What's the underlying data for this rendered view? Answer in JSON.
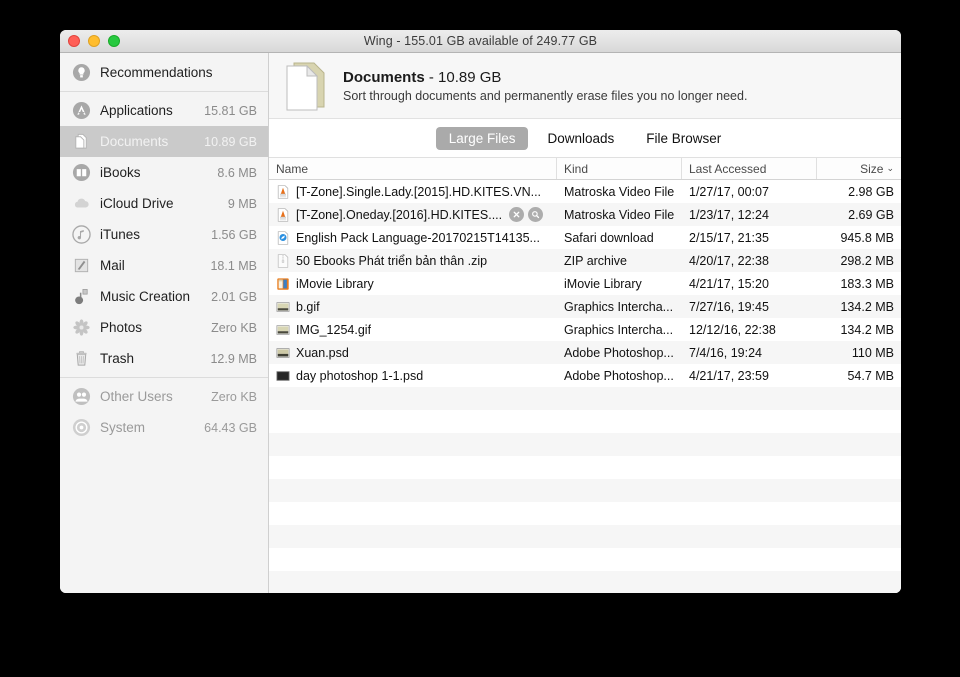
{
  "window": {
    "title": "Wing - 155.01 GB available of 249.77 GB"
  },
  "traffic": {
    "close": "close-button",
    "minimize": "minimize-button",
    "zoom": "zoom-button"
  },
  "sidebar": {
    "items": [
      {
        "label": "Recommendations",
        "size": "",
        "icon": "lightbulb-icon",
        "selected": false,
        "dim": false
      },
      {
        "label": "Applications",
        "size": "15.81 GB",
        "icon": "app-store-icon",
        "selected": false,
        "dim": false
      },
      {
        "label": "Documents",
        "size": "10.89 GB",
        "icon": "documents-icon",
        "selected": true,
        "dim": false
      },
      {
        "label": "iBooks",
        "size": "8.6 MB",
        "icon": "book-icon",
        "selected": false,
        "dim": false
      },
      {
        "label": "iCloud Drive",
        "size": "9 MB",
        "icon": "cloud-icon",
        "selected": false,
        "dim": false
      },
      {
        "label": "iTunes",
        "size": "1.56 GB",
        "icon": "music-note-icon",
        "selected": false,
        "dim": false
      },
      {
        "label": "Mail",
        "size": "18.1 MB",
        "icon": "mail-stamp-icon",
        "selected": false,
        "dim": false
      },
      {
        "label": "Music Creation",
        "size": "2.01 GB",
        "icon": "guitar-icon",
        "selected": false,
        "dim": false
      },
      {
        "label": "Photos",
        "size": "Zero KB",
        "icon": "photos-flower-icon",
        "selected": false,
        "dim": false
      },
      {
        "label": "Trash",
        "size": "12.9 MB",
        "icon": "trash-icon",
        "selected": false,
        "dim": false
      },
      {
        "label": "Other Users",
        "size": "Zero KB",
        "icon": "users-icon",
        "selected": false,
        "dim": true
      },
      {
        "label": "System",
        "size": "64.43 GB",
        "icon": "system-gear-icon",
        "selected": false,
        "dim": true
      }
    ]
  },
  "header": {
    "icon": "documents-stack-icon",
    "title_name": "Documents",
    "title_size": " - 10.89 GB",
    "subtitle": "Sort through documents and permanently erase files you no longer need."
  },
  "tabs": [
    {
      "label": "Large Files",
      "active": true
    },
    {
      "label": "Downloads",
      "active": false
    },
    {
      "label": "File Browser",
      "active": false
    }
  ],
  "table": {
    "columns": [
      {
        "label": "Name",
        "align": "left"
      },
      {
        "label": "Kind",
        "align": "left"
      },
      {
        "label": "Last Accessed",
        "align": "left"
      },
      {
        "label": "Size",
        "align": "right",
        "sort_chevron": "⌄"
      }
    ],
    "rows": [
      {
        "name": "[T-Zone].Single.Lady.[2015].HD.KITES.VN...",
        "kind": "Matroska Video File",
        "accessed": "1/27/17, 00:07",
        "size": "2.98 GB",
        "icon": "vlc-file-icon",
        "actions": false
      },
      {
        "name": "[T-Zone].Oneday.[2016].HD.KITES....",
        "kind": "Matroska Video File",
        "accessed": "1/23/17, 12:24",
        "size": "2.69 GB",
        "icon": "vlc-file-icon",
        "actions": true,
        "action_delete": "delete-file-button",
        "action_reveal": "reveal-file-button"
      },
      {
        "name": "English Pack Language-20170215T14135...",
        "kind": "Safari download",
        "accessed": "2/15/17, 21:35",
        "size": "945.8 MB",
        "icon": "safari-download-icon",
        "actions": false
      },
      {
        "name": "50 Ebooks Phát triển bản thân .zip",
        "kind": "ZIP archive",
        "accessed": "4/20/17, 22:38",
        "size": "298.2 MB",
        "icon": "zip-archive-icon",
        "actions": false
      },
      {
        "name": "iMovie Library",
        "kind": "iMovie Library",
        "accessed": "4/21/17, 15:20",
        "size": "183.3 MB",
        "icon": "imovie-library-icon",
        "actions": false
      },
      {
        "name": "b.gif",
        "kind": "Graphics Intercha...",
        "accessed": "7/27/16, 19:45",
        "size": "134.2 MB",
        "icon": "gif-image-icon",
        "actions": false
      },
      {
        "name": "IMG_1254.gif",
        "kind": "Graphics Intercha...",
        "accessed": "12/12/16, 22:38",
        "size": "134.2 MB",
        "icon": "gif-image-icon",
        "actions": false
      },
      {
        "name": "Xuan.psd",
        "kind": "Adobe Photoshop...",
        "accessed": "7/4/16, 19:24",
        "size": "110 MB",
        "icon": "psd-image-icon",
        "actions": false
      },
      {
        "name": "day photoshop 1-1.psd",
        "kind": "Adobe Photoshop...",
        "accessed": "4/21/17, 23:59",
        "size": "54.7 MB",
        "icon": "psd-dark-icon",
        "actions": false
      }
    ],
    "empty_row_count": 9
  },
  "colors": {
    "selection": "#cacaca",
    "tab_active": "#aaaaaa",
    "stripe": "#f6f6f6",
    "sidebar_bg": "#f4f4f4",
    "close": "#ff5f57",
    "minimize": "#ffbd2e",
    "zoom": "#28c940"
  }
}
